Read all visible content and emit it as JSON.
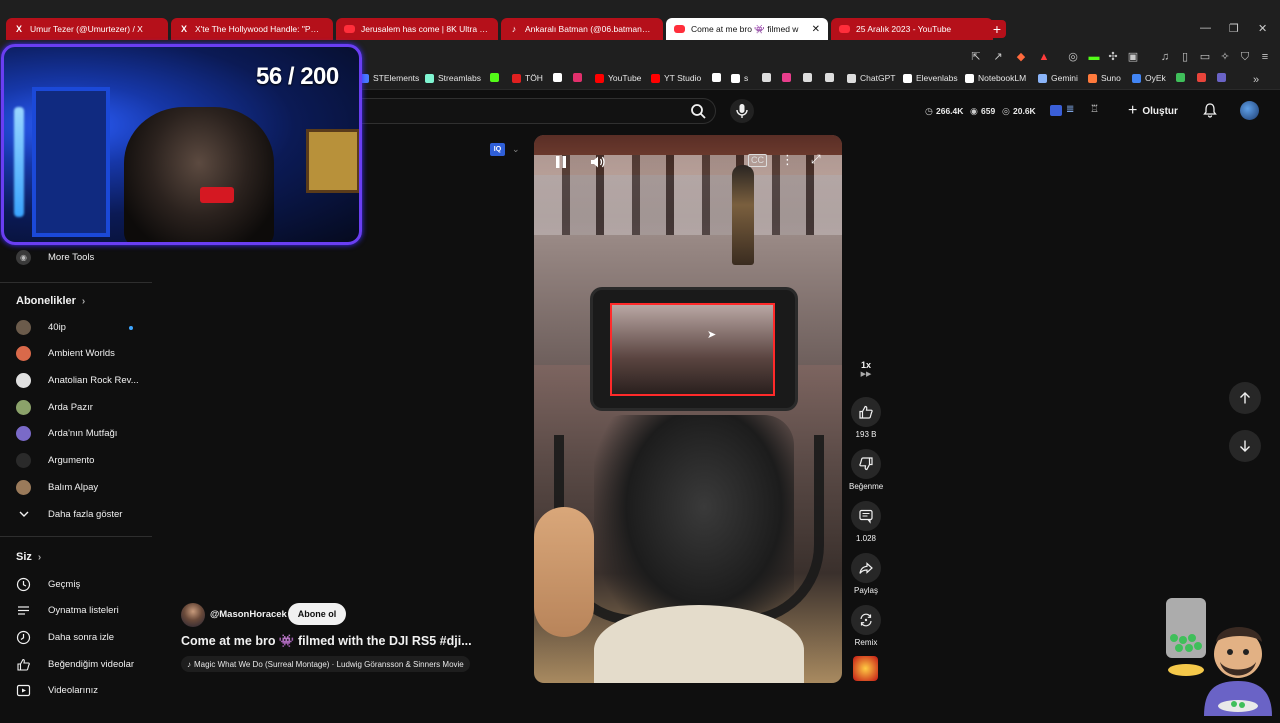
{
  "tabs": [
    {
      "icon": "x-icon",
      "label": "Umur Tezer (@Umurtezer) / X",
      "active": false
    },
    {
      "icon": "x-icon",
      "label": "X'te The Hollywood Handle: \"PROJEC",
      "active": false
    },
    {
      "icon": "youtube-icon",
      "label": "Jerusalem has come | 8K Ultra HD Ci",
      "active": false
    },
    {
      "icon": "tiktok-icon",
      "label": "Ankaralı Batman (@06.batmann) | Tik",
      "active": false
    },
    {
      "icon": "youtube-icon",
      "label": "Come at me bro 👾 filmed w",
      "active": true
    },
    {
      "icon": "youtube-icon",
      "label": "25 Aralık 2023 - YouTube",
      "active": false
    }
  ],
  "newtab_label": "+",
  "bookmarks": [
    {
      "label": "STElements",
      "color": "#4a7bff"
    },
    {
      "label": "Streamlabs",
      "color": "#80f5d2"
    },
    {
      "label": "",
      "color": "#53fc18"
    },
    {
      "label": "TÖH",
      "color": "#e02020"
    },
    {
      "label": "",
      "color": "#ffffff"
    },
    {
      "label": "",
      "color": "#e1306c"
    },
    {
      "label": "YouTube",
      "color": "#ff0000"
    },
    {
      "label": "YT Studio",
      "color": "#ff0000"
    },
    {
      "label": "",
      "color": "#ffffff"
    },
    {
      "label": "s",
      "color": "#ffffff"
    },
    {
      "label": "",
      "color": "#dddddd"
    },
    {
      "label": "",
      "color": "#e83e8c"
    },
    {
      "label": "",
      "color": "#dddddd"
    },
    {
      "label": "",
      "color": "#dddddd"
    },
    {
      "label": "ChatGPT",
      "color": "#dddddd"
    },
    {
      "label": "Elevenlabs",
      "color": "#ffffff"
    },
    {
      "label": "NotebookLM",
      "color": "#ffffff"
    },
    {
      "label": "Gemini",
      "color": "#8ab4f8"
    },
    {
      "label": "Suno",
      "color": "#ff7a3c"
    },
    {
      "label": "OyEk",
      "color": "#4285f4"
    }
  ],
  "header": {
    "stats": [
      "266.4K",
      "659",
      "20.6K"
    ],
    "create_label": "Oluştur"
  },
  "webcam": {
    "counter": "56 / 200"
  },
  "sidebar": {
    "more_tools": "More Tools",
    "subscriptions_heading": "Abonelikler",
    "channels": [
      {
        "name": "40ip",
        "color": "#6b5b4b"
      },
      {
        "name": "Ambient Worlds",
        "color": "#d9694a"
      },
      {
        "name": "Anatolian Rock Rev...",
        "color": "#e0e0e0"
      },
      {
        "name": "Arda Pazır",
        "color": "#8ba26a"
      },
      {
        "name": "Arda'nın Mutfağı",
        "color": "#7a6ac8"
      },
      {
        "name": "Argumento",
        "color": "#2a2a2a"
      },
      {
        "name": "Balım Alpay",
        "color": "#9a7a5a"
      }
    ],
    "show_more": "Daha fazla göster",
    "you_heading": "Siz",
    "you_items": [
      {
        "label": "Geçmiş",
        "icon": "history-icon"
      },
      {
        "label": "Oynatma listeleri",
        "icon": "playlists-icon"
      },
      {
        "label": "Daha sonra izle",
        "icon": "watch-later-icon"
      },
      {
        "label": "Beğendiğim videolar",
        "icon": "liked-videos-icon"
      },
      {
        "label": "Videolarınız",
        "icon": "your-videos-icon"
      }
    ]
  },
  "player": {
    "speed_label": "1x",
    "likes": "193 B",
    "dislike_label": "Beğenme",
    "comments": "1.028",
    "share_label": "Paylaş",
    "remix_label": "Remix"
  },
  "video": {
    "channel": "@MasonHoracek",
    "subscribe_label": "Abone ol",
    "title": "Come at me bro 👾 filmed with the DJI RS5 #dji...",
    "song": "Magic What We Do (Surreal Montage) · Ludwig Göransson & Sinners Movie"
  },
  "colors": {
    "tab_red": "#b5101a",
    "accent_blue": "#3ea6ff",
    "webcam_border": "#6a3ef2"
  }
}
